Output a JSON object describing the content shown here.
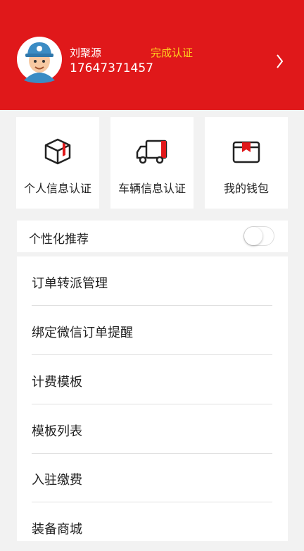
{
  "profile": {
    "name": "刘聚源",
    "status": "完成认证",
    "phone": "17647371457"
  },
  "quick_actions": [
    {
      "label": "个人信息认证",
      "icon": "package-box-icon"
    },
    {
      "label": "车辆信息认证",
      "icon": "truck-icon"
    },
    {
      "label": "我的钱包",
      "icon": "wallet-icon"
    }
  ],
  "recommendation": {
    "label": "个性化推荐",
    "enabled": false
  },
  "menu": {
    "items": [
      {
        "label": "订单转派管理"
      },
      {
        "label": "绑定微信订单提醒"
      },
      {
        "label": "计费模板"
      },
      {
        "label": "模板列表"
      },
      {
        "label": "入驻缴费"
      },
      {
        "label": "装备商城"
      }
    ]
  },
  "colors": {
    "brand_red": "#e0181a",
    "status_yellow": "#ffd21f"
  }
}
